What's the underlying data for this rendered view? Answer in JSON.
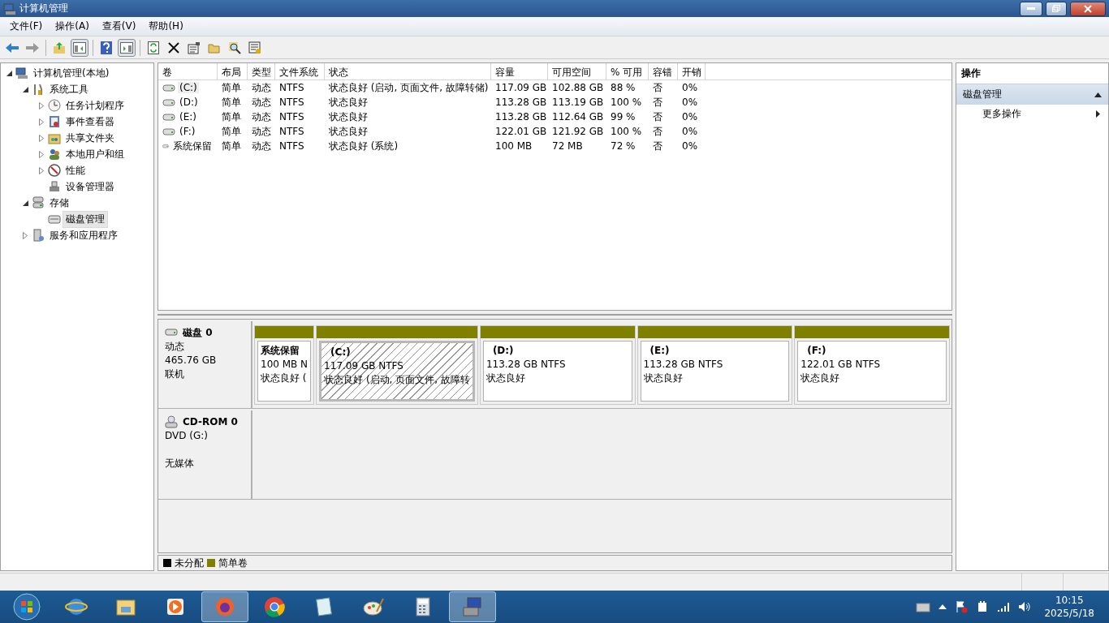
{
  "window": {
    "title": "计算机管理"
  },
  "menu": [
    "文件(F)",
    "操作(A)",
    "查看(V)",
    "帮助(H)"
  ],
  "tree": [
    {
      "label": "计算机管理(本地)",
      "expanded": true,
      "selected": false,
      "children": [
        {
          "label": "系统工具",
          "expanded": true,
          "selected": false,
          "children": [
            {
              "label": "任务计划程序",
              "expanded": false,
              "selected": false
            },
            {
              "label": "事件查看器",
              "expanded": false,
              "selected": false
            },
            {
              "label": "共享文件夹",
              "expanded": false,
              "selected": false
            },
            {
              "label": "本地用户和组",
              "expanded": false,
              "selected": false
            },
            {
              "label": "性能",
              "expanded": false,
              "selected": false
            },
            {
              "label": "设备管理器",
              "selected": false
            }
          ]
        },
        {
          "label": "存储",
          "expanded": true,
          "selected": false,
          "children": [
            {
              "label": "磁盘管理",
              "selected": true
            }
          ]
        },
        {
          "label": "服务和应用程序",
          "expanded": false,
          "selected": false
        }
      ]
    }
  ],
  "volumes": {
    "columns": [
      "卷",
      "布局",
      "类型",
      "文件系统",
      "状态",
      "容量",
      "可用空间",
      "% 可用",
      "容错",
      "开销"
    ],
    "rows": [
      {
        "selected": true,
        "cells": [
          "(C:)",
          "简单",
          "动态",
          "NTFS",
          "状态良好 (启动, 页面文件, 故障转储)",
          "117.09 GB",
          "102.88 GB",
          "88 %",
          "否",
          "0%"
        ]
      },
      {
        "selected": false,
        "cells": [
          "(D:)",
          "简单",
          "动态",
          "NTFS",
          "状态良好",
          "113.28 GB",
          "113.19 GB",
          "100 %",
          "否",
          "0%"
        ]
      },
      {
        "selected": false,
        "cells": [
          "(E:)",
          "简单",
          "动态",
          "NTFS",
          "状态良好",
          "113.28 GB",
          "112.64 GB",
          "99 %",
          "否",
          "0%"
        ]
      },
      {
        "selected": false,
        "cells": [
          "(F:)",
          "简单",
          "动态",
          "NTFS",
          "状态良好",
          "122.01 GB",
          "121.92 GB",
          "100 %",
          "否",
          "0%"
        ]
      },
      {
        "selected": false,
        "cells": [
          "系统保留",
          "简单",
          "动态",
          "NTFS",
          "状态良好 (系统)",
          "100 MB",
          "72 MB",
          "72 %",
          "否",
          "0%"
        ]
      }
    ]
  },
  "disks": [
    {
      "kind": "disk",
      "name": "磁盘 0",
      "lines": [
        "动态",
        "465.76 GB",
        "联机"
      ],
      "partitions": [
        {
          "title": "系统保留",
          "size": "100 MB N",
          "status": "状态良好 (",
          "color": "#808000",
          "selected": false
        },
        {
          "title": "(C:)",
          "size": "117.09 GB NTFS",
          "status": "状态良好 (启动, 页面文件, 故障转",
          "color": "#808000",
          "selected": true
        },
        {
          "title": "(D:)",
          "size": "113.28 GB NTFS",
          "status": "状态良好",
          "color": "#808000",
          "selected": false
        },
        {
          "title": "(E:)",
          "size": "113.28 GB NTFS",
          "status": "状态良好",
          "color": "#808000",
          "selected": false
        },
        {
          "title": "(F:)",
          "size": "122.01 GB NTFS",
          "status": "状态良好",
          "color": "#808000",
          "selected": false
        }
      ]
    },
    {
      "kind": "cdrom",
      "name": "CD-ROM 0",
      "lines": [
        "DVD (G:)",
        "无媒体"
      ]
    }
  ],
  "legend": [
    {
      "label": "未分配",
      "color": "#000000"
    },
    {
      "label": "简单卷",
      "color": "#808000"
    }
  ],
  "actions": {
    "title": "操作",
    "sections": [
      {
        "title": "磁盘管理",
        "expanded": true,
        "items": [
          "更多操作"
        ]
      }
    ]
  },
  "taskbar": {
    "apps": [
      {
        "selected": false
      },
      {
        "selected": false
      },
      {
        "selected": false
      },
      {
        "selected": true
      },
      {
        "selected": false
      },
      {
        "selected": false
      },
      {
        "selected": false
      },
      {
        "selected": false
      },
      {
        "selected": true
      }
    ],
    "time": "10:15",
    "date": "2025/5/18"
  }
}
